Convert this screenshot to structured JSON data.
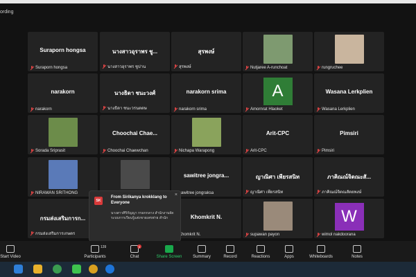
{
  "window": {
    "recording_label": "ording"
  },
  "tiles": [
    {
      "name": "Suraporn hongsa",
      "caption": "Suraporn hongsa",
      "type": "text"
    },
    {
      "name": "นางสาวอุราพร ชู...",
      "caption": "นางสาวอุราพร ชูปาน",
      "type": "text"
    },
    {
      "name": "สุรพงษ์",
      "caption": "สุรพงษ์",
      "type": "text"
    },
    {
      "name": "",
      "caption": "Nutjaree A-runchoat",
      "type": "photo",
      "color": "#7e9a70"
    },
    {
      "name": "",
      "caption": "rungruchee",
      "type": "photo",
      "color": "#c9b59e"
    },
    {
      "name": "narakorn",
      "caption": "narakorn",
      "type": "text"
    },
    {
      "name": "นางธิดา ชนะวงศ์",
      "caption": "นางธิดา ชนะวรนตตษ",
      "type": "text"
    },
    {
      "name": "narakorn srima",
      "caption": "narakorn srima",
      "type": "text"
    },
    {
      "name": "A",
      "caption": "Amornrat Hlaoket",
      "type": "avatar",
      "color": "#2f7d36"
    },
    {
      "name": "Wasana Lerkplien",
      "caption": "Wasana Lerkplien",
      "type": "text"
    },
    {
      "name": "",
      "caption": "Sorada Sriprasit",
      "type": "photo",
      "color": "#6c8c4a"
    },
    {
      "name": "Choochai Chae...",
      "caption": "Choochai Chaewchan",
      "type": "text"
    },
    {
      "name": "",
      "caption": "Nichapa Warapong",
      "type": "photo",
      "color": "#8aa35c"
    },
    {
      "name": "Arit-CPC",
      "caption": "Arit-CPC",
      "type": "text"
    },
    {
      "name": "Pimsiri",
      "caption": "Pimsiri",
      "type": "text"
    },
    {
      "name": "",
      "caption": "NIRAWAN SRITHONG",
      "type": "photo",
      "color": "#5a7ab8"
    },
    {
      "name": "",
      "caption": "",
      "type": "photo",
      "color": "#4a4a4a"
    },
    {
      "name": "sawitree jongra...",
      "caption": "sawitree jongraksa",
      "type": "text"
    },
    {
      "name": "ญาณิศา เพียรสนิท",
      "caption": "ญาณิศา เพียรสนิท",
      "type": "text"
    },
    {
      "name": "ภาคิณณ์จิดณะสั...",
      "caption": "ภาคิณณ์จิตณสัตยพงษ์",
      "type": "text"
    },
    {
      "name": "กรมส่งเสริมการก...",
      "caption": "กรมส่งเสริมการเกษตร",
      "type": "text"
    },
    {
      "name": "",
      "caption": "",
      "type": "empty"
    },
    {
      "name": "Khomkrit N.",
      "caption": "Khomkrit N.",
      "type": "text"
    },
    {
      "name": "",
      "caption": "supawan payon",
      "type": "photo",
      "color": "#9a8a7a"
    },
    {
      "name": "W",
      "caption": "wimol nakdoorana",
      "type": "avatar",
      "color": "#8a2fb8"
    }
  ],
  "chat_popup": {
    "initials": "SK",
    "title": "From Sirikanya krokklang to Everyone",
    "message": "นางสาวศิริกัญญา กรอกกลาง สำนักงานจัดระบบการเรียนรู้แต่งขายเพรพ่าย สำนัก",
    "close": "×"
  },
  "toolbar": {
    "start_video": "Start Video",
    "participants": "Participants",
    "participants_count": "139",
    "chat": "Chat",
    "chat_badge": "9",
    "share": "Share Screen",
    "summary": "Summary",
    "record": "Record",
    "reactions": "Reactions",
    "apps": "Apps",
    "whiteboards": "Whiteboards",
    "notes": "Notes"
  },
  "taskbar": {
    "apps": [
      "edge-icon",
      "files-icon",
      "chrome-icon",
      "line-icon",
      "chrome-icon",
      "zoom-icon"
    ]
  }
}
